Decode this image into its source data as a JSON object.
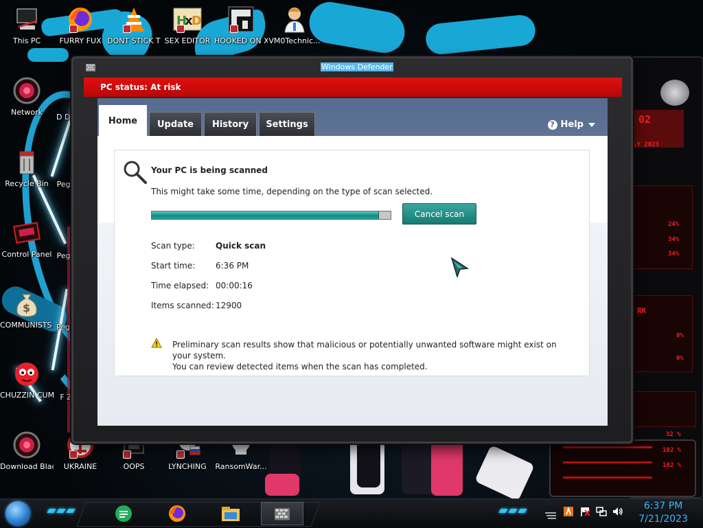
{
  "desktop": {
    "icons": [
      {
        "label": "This PC",
        "icon": "pc-icon"
      },
      {
        "label": "FURRY FUX",
        "icon": "firefox-icon"
      },
      {
        "label": "DONT STICK THIS IN YO...",
        "icon": "vlc-icon"
      },
      {
        "label": "SEX EDITOR",
        "icon": "hxd-icon"
      },
      {
        "label": "HOOKED ON XONIX",
        "icon": "xonix-icon"
      },
      {
        "label": "VM0Technic...",
        "icon": "doctor-icon"
      },
      {
        "label": "Network",
        "icon": "network-icon"
      },
      {
        "label": "Recycle Bin",
        "icon": "recycle-bin-icon"
      },
      {
        "label": "Control Panel",
        "icon": "control-panel-icon"
      },
      {
        "label": "COMMUNISTS HATE THIS G...",
        "icon": "money-bag-icon"
      },
      {
        "label": "CHUZZIN CUM",
        "icon": "chuzzle-icon"
      },
      {
        "label": "Download Black Ali...",
        "icon": "alienware-icon"
      },
      {
        "label": "UKRAINE",
        "icon": "ukraine-icon"
      },
      {
        "label": "OOPS",
        "icon": "oops-icon"
      },
      {
        "label": "LYNCHING",
        "icon": "lynching-icon"
      },
      {
        "label": "RansomWar...",
        "icon": "skull-icon"
      },
      {
        "label": "D DU",
        "icon": "partial-icon"
      },
      {
        "label": "Pegg",
        "icon": "partial-icon"
      },
      {
        "label": "Pegg",
        "icon": "partial-icon"
      },
      {
        "label": "Pegg of W",
        "icon": "partial-icon"
      },
      {
        "label": "F Z",
        "icon": "partial-icon"
      }
    ]
  },
  "window": {
    "title": "Windows Defender",
    "status": "PC status: At risk",
    "status_color": "#d80c0c",
    "tabs": [
      {
        "label": "Home",
        "active": true
      },
      {
        "label": "Update",
        "active": false
      },
      {
        "label": "History",
        "active": false
      },
      {
        "label": "Settings",
        "active": false
      }
    ],
    "help_label": "Help",
    "scan": {
      "title": "Your PC is being scanned",
      "description": "This might take some time, depending on the type of scan selected.",
      "progress": 0.95,
      "cancel_label": "Cancel scan",
      "details": [
        {
          "label": "Scan type:",
          "value": "Quick scan",
          "bold": true
        },
        {
          "label": "Start time:",
          "value": "6:36 PM",
          "bold": false
        },
        {
          "label": "Time elapsed:",
          "value": "00:00:16",
          "bold": false
        },
        {
          "label": "Items scanned:",
          "value": "12900",
          "bold": false
        }
      ],
      "warning_line1": "Preliminary scan results show that malicious or potentially unwanted software might exist on your system.",
      "warning_line2": "You can review detected items when the scan has completed."
    },
    "accent": "#1d8a84"
  },
  "hud": {
    "labels": [
      "02",
      "LY 2023",
      "24%",
      "34%",
      "34%",
      "RK",
      "0%",
      "0%",
      "32 %",
      "102 %",
      "102 %"
    ]
  },
  "taskbar": {
    "apps": [
      "notes-icon",
      "firefox-icon",
      "file-explorer-icon",
      "defender-icon"
    ],
    "tray": [
      "shield-icon",
      "flag-icon",
      "network-icon",
      "volume-icon"
    ],
    "time": "6:37 PM",
    "date": "7/21/2023"
  }
}
